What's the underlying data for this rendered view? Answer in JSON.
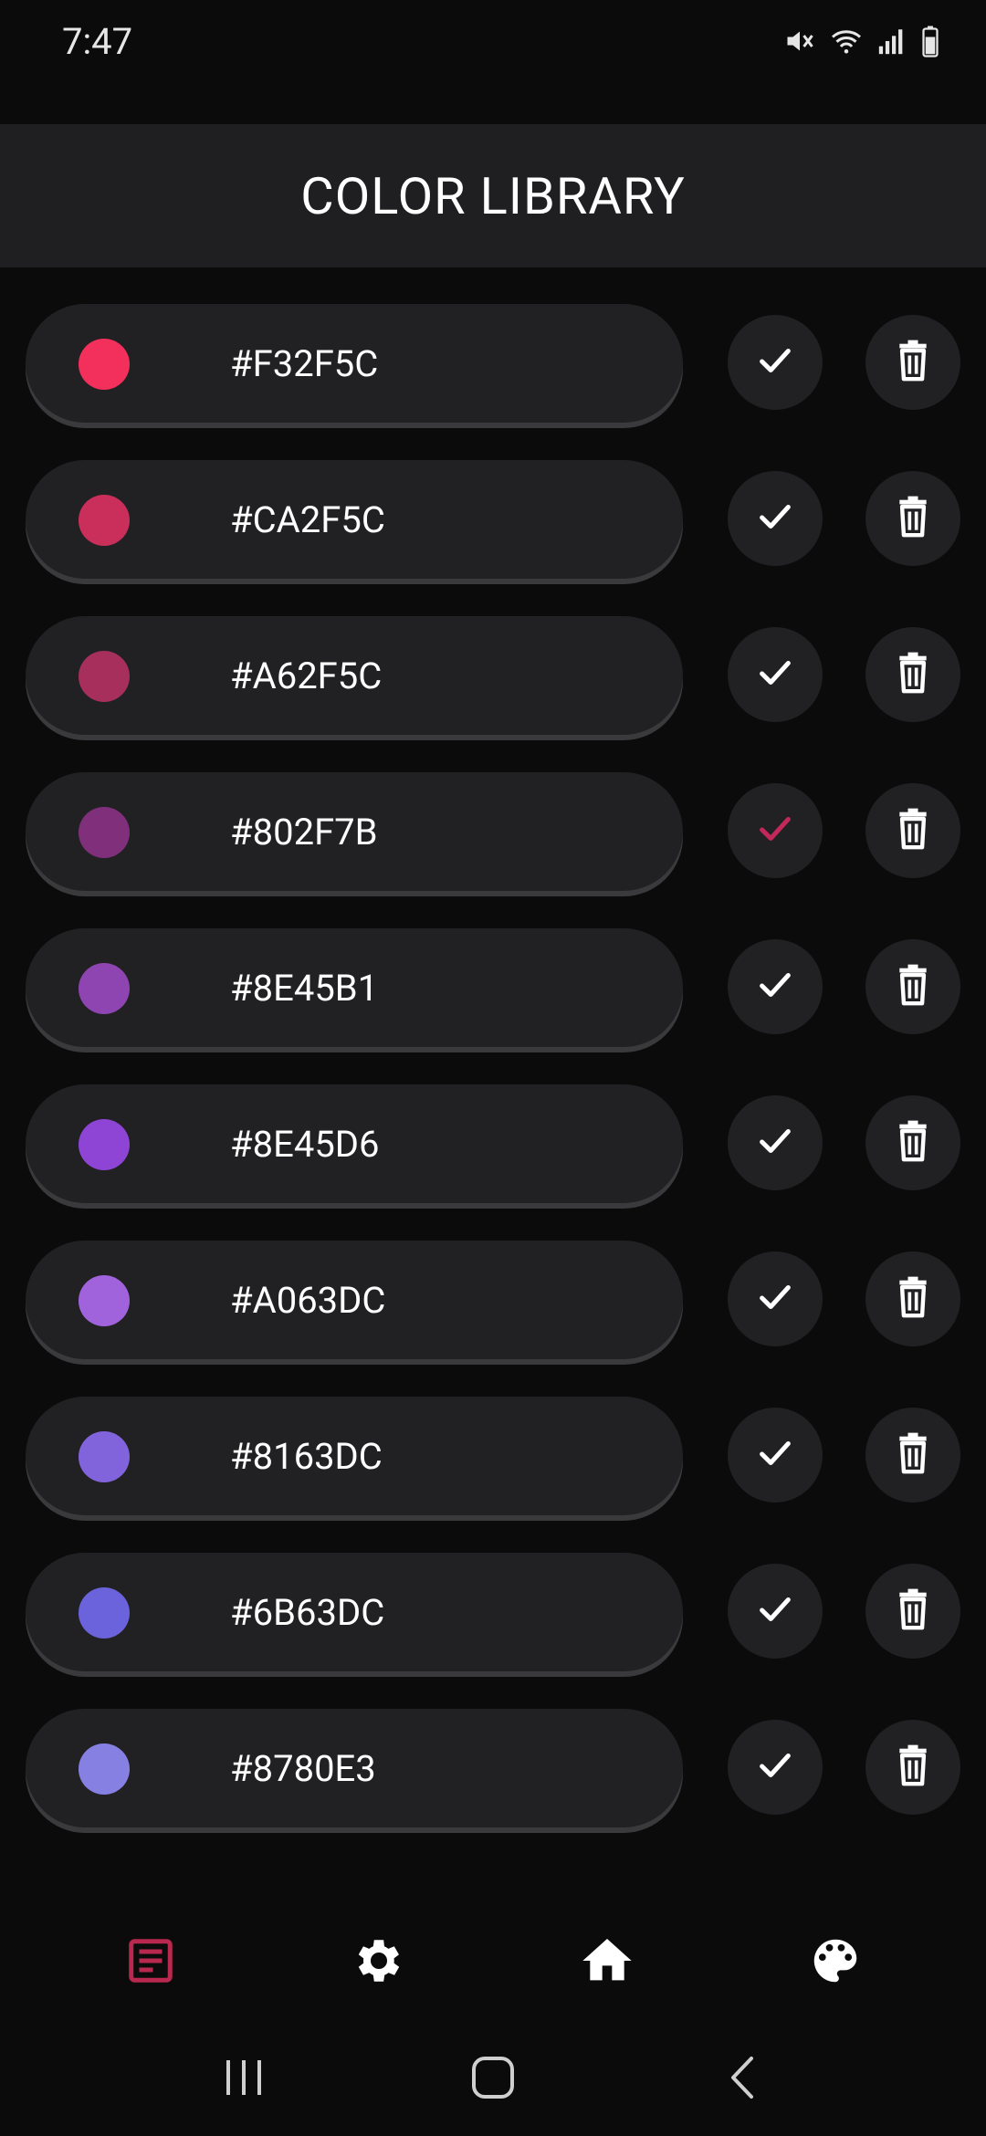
{
  "status_bar": {
    "time": "7:47"
  },
  "header": {
    "title": "COLOR LIBRARY"
  },
  "theme": {
    "accent": "#C2285A",
    "surface": "#212123",
    "background": "#0b0b0c"
  },
  "colors": [
    {
      "hex": "#F32F5C",
      "swatch": "#F32F5C",
      "selected": false
    },
    {
      "hex": "#CA2F5C",
      "swatch": "#CA2F5C",
      "selected": false
    },
    {
      "hex": "#A62F5C",
      "swatch": "#A62F5C",
      "selected": false
    },
    {
      "hex": "#802F7B",
      "swatch": "#802F7B",
      "selected": true
    },
    {
      "hex": "#8E45B1",
      "swatch": "#8E45B1",
      "selected": false
    },
    {
      "hex": "#8E45D6",
      "swatch": "#8E45D6",
      "selected": false
    },
    {
      "hex": "#A063DC",
      "swatch": "#A063DC",
      "selected": false
    },
    {
      "hex": "#8163DC",
      "swatch": "#8163DC",
      "selected": false
    },
    {
      "hex": "#6B63DC",
      "swatch": "#6B63DC",
      "selected": false
    },
    {
      "hex": "#8780E3",
      "swatch": "#8780E3",
      "selected": false
    }
  ],
  "bottom_nav": {
    "items": [
      {
        "icon": "library-icon",
        "active": true
      },
      {
        "icon": "settings-icon",
        "active": false
      },
      {
        "icon": "home-icon",
        "active": false
      },
      {
        "icon": "palette-icon",
        "active": false
      }
    ]
  }
}
